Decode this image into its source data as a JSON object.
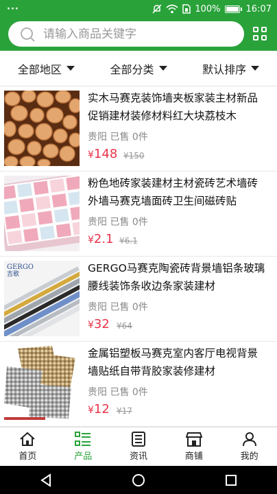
{
  "status_bar": {
    "left": "···",
    "battery": "100%",
    "time": "16:07"
  },
  "search": {
    "placeholder": "请输入商品关键字"
  },
  "filters": [
    "全部地区",
    "全部分类",
    "默认排序"
  ],
  "products": [
    {
      "title": "实木马赛克装饰墙夹板家装主材新品促销建材装修材料红大块荔枝木",
      "location": "贵阳",
      "sold": "已售 0件",
      "price": "148",
      "old_price": "¥150"
    },
    {
      "title": "粉色地砖家装建材主材瓷砖艺术墙砖外墙马赛克墙面砖卫生间磁砖贴",
      "location": "贵阳",
      "sold": "已售 0件",
      "price": "2.1",
      "old_price": "¥6.1"
    },
    {
      "title": "GERGO马赛克陶瓷砖背景墙铝条玻璃腰线装饰条收边条家装建材",
      "location": "贵阳",
      "sold": "已售 0件",
      "price": "32",
      "old_price": "¥64"
    },
    {
      "title": "金属铝塑板马赛克室内客厅电视背景墙贴纸自带背胶家装修建材",
      "location": "贵阳",
      "sold": "已售 0件",
      "price": "12",
      "old_price": "¥17"
    }
  ],
  "currency": "¥",
  "thumb3_brand": {
    "en": "GERGO",
    "cn": "吉歌"
  },
  "tabs": [
    {
      "label": "首页",
      "icon": "home-icon",
      "active": false
    },
    {
      "label": "产品",
      "icon": "product-list-icon",
      "active": true
    },
    {
      "label": "资讯",
      "icon": "news-icon",
      "active": false
    },
    {
      "label": "商铺",
      "icon": "shop-icon",
      "active": false
    },
    {
      "label": "我的",
      "icon": "user-icon",
      "active": false
    }
  ],
  "colors": {
    "brand_green": "#2aa23a",
    "price_red": "#e8334a"
  }
}
